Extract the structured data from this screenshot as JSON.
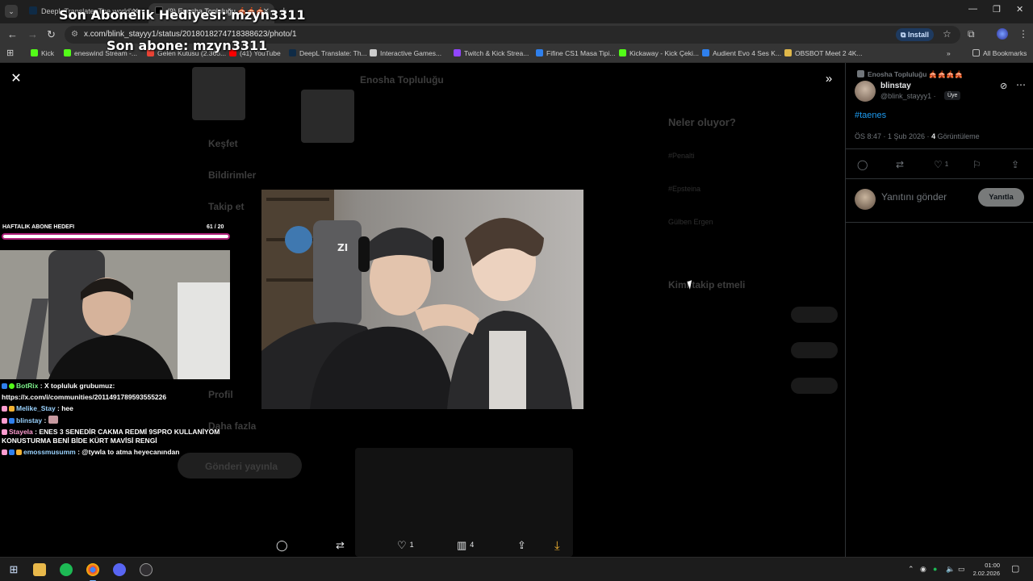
{
  "browser": {
    "tabs": [
      {
        "title": "DeepL Translate: The world's m",
        "active": false
      },
      {
        "title": "(9) Enosha Topluluğu 🎪🎪🎪",
        "active": true
      }
    ],
    "url": "x.com/blink_stayyy1/status/2018018274718388623/photo/1",
    "install_label": "Install",
    "bookmarks": [
      "Kick",
      "eneswind Stream -...",
      "Gelen Kutusu (2.368...",
      "(41) YouTube",
      "DeepL Translate: Th...",
      "Interactive Games...",
      "Twitch & Kick Strea...",
      "Fifine CS1 Masa Tipi...",
      "Kickaway - Kick Çeki...",
      "Audient Evo 4 Ses K...",
      "OBSBOT Meet 2 4K..."
    ],
    "all_bookmarks_label": "All Bookmarks",
    "accent": "#1e3a5f"
  },
  "stream_overlay": {
    "gift_title": "Son Abonelik Hediyesi: mzyn3311",
    "last_sub": "Son abone: mzyn3311",
    "goal_label": "HAFTALIK ABONE HEDEFI",
    "goal_count": "61 / 20",
    "goal_progress": 1.0,
    "goal_color": "#b0207a",
    "chat": [
      {
        "user": "BotRix",
        "message": "X topluluk grubumuz:",
        "color": "#7cf08a"
      },
      {
        "user": "",
        "message": "https://x.com/i/communities/2011491789593555226",
        "color": "#ffffff"
      },
      {
        "user": "Melike_Stay",
        "message": "hee",
        "color": "#9ad3ff"
      },
      {
        "user": "blinstay",
        "message": "",
        "color": "#9ad3ff"
      },
      {
        "user": "Stayela",
        "message": "ENES 3 SENEDİR CAKMA REDMİ 9SPRO KULLANİYOM KONUSTURMA BENİ BİDE KÜRT MAVİSİ RENGİ",
        "color": "#ff9dd0"
      },
      {
        "user": "emossmusumm",
        "message": "@tywla to atma heyecanından",
        "color": "#9ad3ff"
      }
    ]
  },
  "viewer": {
    "actions": {
      "likes": "1",
      "views": "4"
    },
    "download_color": "#f2b233"
  },
  "background_page": {
    "community_title": "Enosha Topluluğu",
    "nav": [
      "Keşfet",
      "Bildirimler",
      "Takip et",
      "Profil",
      "Daha fazla"
    ],
    "post_button": "Gönderi yayınla",
    "trending_title": "Neler oluyor?",
    "trends": [
      "#Penalti",
      "#Epsteina",
      "Gülben Ergen"
    ],
    "who_to_follow_title": "Kimi takip etmeli",
    "follow_label": "Takip et"
  },
  "right_panel": {
    "community": "Enosha Topluluğu 🎪🎪🎪🎪",
    "author_name": "blinstay",
    "author_handle": "@blink_stayyy1 ·",
    "member_badge": "Üye",
    "hashtag": "#taenes",
    "timestamp": "ÖS 8:47 · 1 Şub 2026 ·",
    "views_count": "4",
    "views_label": "Görüntüleme",
    "likes": "1",
    "reply_placeholder": "Yanıtını gönder",
    "reply_button": "Yanıtla",
    "link_color": "#1d9bf0"
  },
  "taskbar": {
    "time": "01:00",
    "date": "2.02.2026"
  }
}
